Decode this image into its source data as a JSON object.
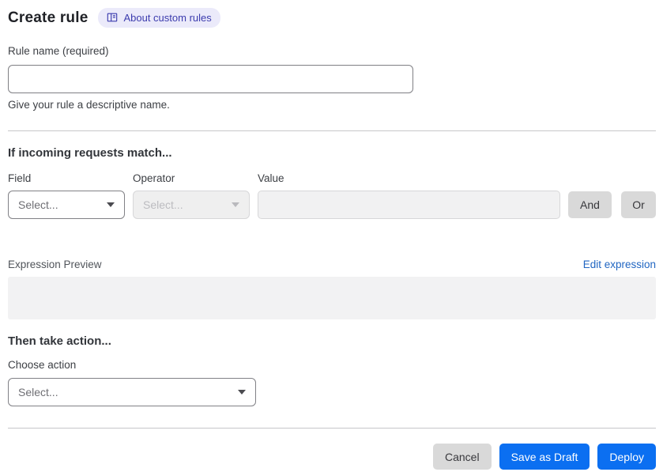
{
  "header": {
    "title": "Create rule",
    "badge": {
      "label": "About custom rules",
      "icon": "book-icon"
    }
  },
  "rule_name": {
    "label": "Rule name (required)",
    "value": "",
    "placeholder": "",
    "helper": "Give your rule a descriptive name."
  },
  "match_section": {
    "heading": "If incoming requests match...",
    "field": {
      "label": "Field",
      "selected": "Select..."
    },
    "operator": {
      "label": "Operator",
      "selected": "Select...",
      "disabled": true
    },
    "value": {
      "label": "Value",
      "value": "",
      "disabled": true
    },
    "and_button": "And",
    "or_button": "Or",
    "expression_preview_label": "Expression Preview",
    "edit_expression_link": "Edit expression",
    "expression_value": ""
  },
  "action_section": {
    "heading": "Then take action...",
    "choose_action_label": "Choose action",
    "action_select": {
      "selected": "Select..."
    }
  },
  "footer": {
    "cancel_label": "Cancel",
    "save_draft_label": "Save as Draft",
    "deploy_label": "Deploy"
  },
  "colors": {
    "primary_blue": "#0b6ff1",
    "link_blue": "#2166c2",
    "badge_bg": "#ebeafa",
    "badge_text": "#3c3cae",
    "neutral_button_bg": "#d9d9d9",
    "disabled_field_bg": "#efefef",
    "preview_box_bg": "#f2f2f3",
    "divider": "#c7c7c9"
  }
}
